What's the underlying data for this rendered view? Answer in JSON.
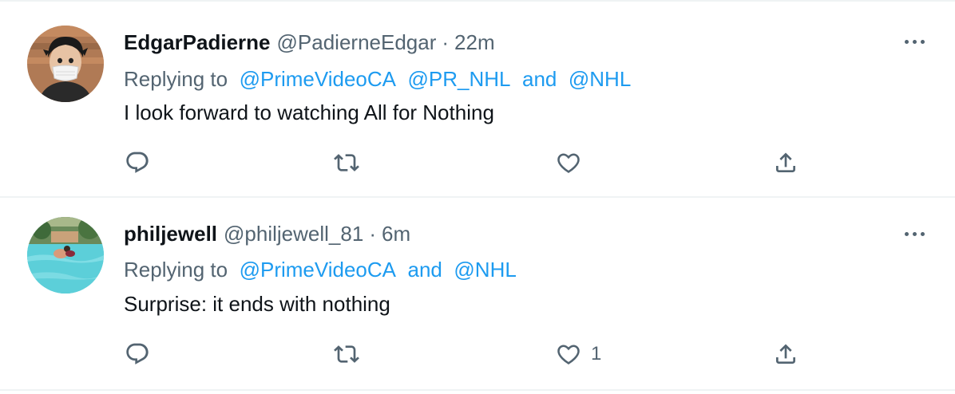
{
  "tweets": [
    {
      "display_name": "EdgarPadierne",
      "handle": "@PadierneEdgar",
      "separator": "·",
      "time": "22m",
      "replying_prefix": "Replying to",
      "mentions": [
        "@PrimeVideoCA",
        "@PR_NHL",
        "@NHL"
      ],
      "joiner_and": "and",
      "text": "I look forward to watching All for Nothing",
      "like_count": "",
      "avatar_icon": "masked-person-avatar"
    },
    {
      "display_name": "philjewell",
      "handle": "@philjewell_81",
      "separator": "·",
      "time": "6m",
      "replying_prefix": "Replying to",
      "mentions": [
        "@PrimeVideoCA",
        "@NHL"
      ],
      "joiner_and": "and",
      "text": "Surprise: it ends with nothing",
      "like_count": "1",
      "avatar_icon": "pool-photo-avatar"
    }
  ],
  "icons": {
    "reply": "reply-icon",
    "retweet": "retweet-icon",
    "like": "like-icon",
    "share": "share-icon",
    "more": "more-icon"
  },
  "colors": {
    "link": "#1d9bf0",
    "secondary_text": "#536471",
    "primary_text": "#0f1419",
    "divider": "#eff3f4"
  }
}
